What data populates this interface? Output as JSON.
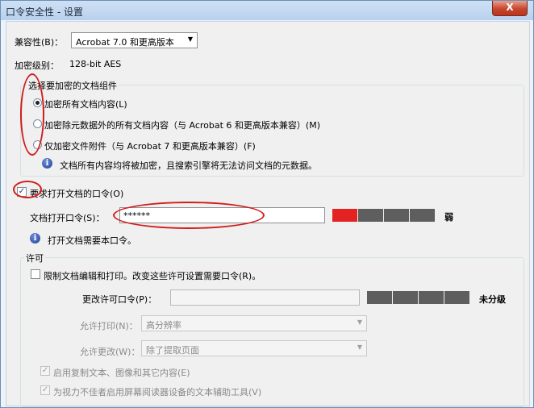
{
  "window": {
    "title": "口令安全性 - 设置",
    "close_label": "X"
  },
  "compat": {
    "label": "兼容性(B)：",
    "value": "Acrobat 7.0 和更高版本"
  },
  "encryption": {
    "label": "加密级别：",
    "value": "128-bit AES"
  },
  "components": {
    "legend": "选择要加密的文档组件",
    "options": [
      {
        "label": "加密所有文档内容(L)",
        "selected": true
      },
      {
        "label": "加密除元数据外的所有文档内容（与 Acrobat 6 和更高版本兼容）(M)",
        "selected": false
      },
      {
        "label": "仅加密文件附件（与 Acrobat 7 和更高版本兼容）(F)",
        "selected": false
      }
    ],
    "info": "文档所有内容均将被加密，且搜索引擎将无法访问文档的元数据。"
  },
  "open_password": {
    "checkbox_label": "要求打开文档的口令(O)",
    "checked": true,
    "field_label": "文档打开口令(S)：",
    "value": "******",
    "strength_label": "弱",
    "strength_level": 0.25,
    "strength_colors": {
      "active": "#e32222",
      "inactive": "#5e5e5e"
    },
    "info": "打开文档需要本口令。"
  },
  "permissions": {
    "legend": "许可",
    "restrict_label": "限制文档编辑和打印。改变这些许可设置需要口令(R)。",
    "restrict_checked": false,
    "perm_password_label": "更改许可口令(P)：",
    "perm_password_value": "",
    "strength_label": "未分级",
    "printing_label": "允许打印(N)：",
    "printing_value": "高分辨率",
    "changes_label": "允许更改(W)：",
    "changes_value": "除了提取页面",
    "copy_label": "启用复制文本、图像和其它内容(E)",
    "copy_checked": true,
    "access_label": "为视力不佳者启用屏幕阅读器设备的文本辅助工具(V)",
    "access_checked": true
  },
  "annotations": {
    "color": "#d11d1d"
  }
}
